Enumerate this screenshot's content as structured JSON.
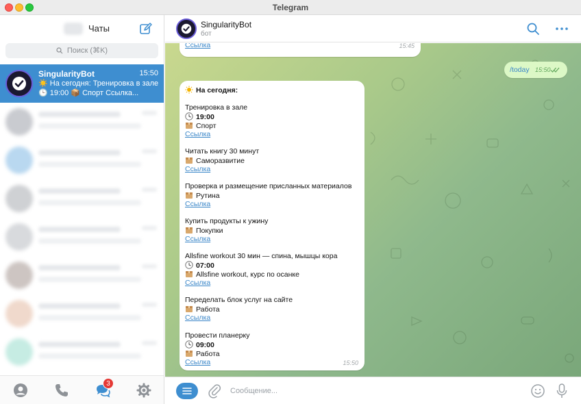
{
  "window": {
    "title": "Telegram"
  },
  "sidebar": {
    "title": "Чаты",
    "search_placeholder": "Поиск (⌘K)",
    "active_chat": {
      "name": "SingularityBot",
      "time": "15:50",
      "preview": "На сегодня:  Тренировка в зале 🕒 19:00 📦 Спорт Ссылка..."
    },
    "footer": {
      "badge_count": "3",
      "icons": [
        "contacts-icon",
        "calls-icon",
        "chats-icon",
        "settings-icon"
      ]
    }
  },
  "chat": {
    "name": "SingularityBot",
    "status": "бот",
    "prev_message": {
      "link": "Ссылка",
      "time": "15:45"
    },
    "command": {
      "text": "/today",
      "time": "15:50"
    },
    "schedule": {
      "header": "На сегодня:",
      "time": "15:50",
      "link_label": "Ссылка",
      "tasks": [
        {
          "title": "Тренировка в зале",
          "time": "19:00",
          "category": "Спорт"
        },
        {
          "title": "Читать книгу 30 минут",
          "category": "Саморазвитие"
        },
        {
          "title": "Проверка и размещение присланных материалов",
          "category": "Рутина"
        },
        {
          "title": "Купить продукты к ужину",
          "category": "Покупки"
        },
        {
          "title": "Allsfine workout 30 мин — спина, мышцы кора",
          "time": "07:00",
          "category": "Allsfine workout, курс по осанке"
        },
        {
          "title": "Переделать блок услуг на сайте",
          "category": "Работа"
        },
        {
          "title": "Провести планерку",
          "time": "09:00",
          "category": "Работа"
        }
      ]
    }
  },
  "composer": {
    "placeholder": "Сообщение..."
  },
  "colors": {
    "accent": "#3e8ed0",
    "outgoing_bubble": "#dcf8c6",
    "link": "#3a86c8",
    "badge": "#e53935"
  }
}
